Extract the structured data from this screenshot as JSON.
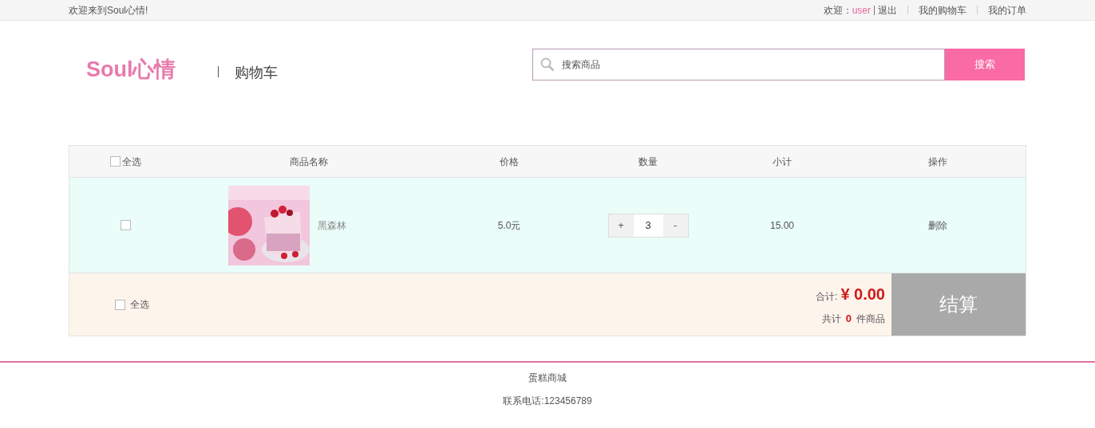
{
  "top_bar": {
    "welcome": "欢迎来到Soul心情!",
    "greeting": "欢迎：",
    "username": "user",
    "logout": "退出",
    "links": [
      "我的购物车",
      "我的订单"
    ]
  },
  "header": {
    "logo": "Soul心情",
    "page_title": "购物车",
    "search": {
      "placeholder": "搜索商品",
      "button": "搜索"
    }
  },
  "cart_table": {
    "select_all": {
      "label": "全选",
      "checked": false
    },
    "columns": [
      "商品名称",
      "价格",
      "数量",
      "小计",
      "操作"
    ],
    "rows": [
      {
        "checked": false,
        "name": "黑森林",
        "price": "5.0元",
        "quantity": "3",
        "increase": "+",
        "decrease": "-",
        "subtotal": "15.00",
        "action": "删除"
      }
    ],
    "footer": {
      "select_all": {
        "label": "全选",
        "checked": false
      },
      "total_label": "合计:",
      "total": "¥ 0.00",
      "count_prefix": "共计",
      "count": "0",
      "count_suffix": "件商品",
      "checkout": "结算"
    }
  },
  "site_footer": {
    "name": "蛋糕商城",
    "phone": "联系电话:123456789"
  }
}
